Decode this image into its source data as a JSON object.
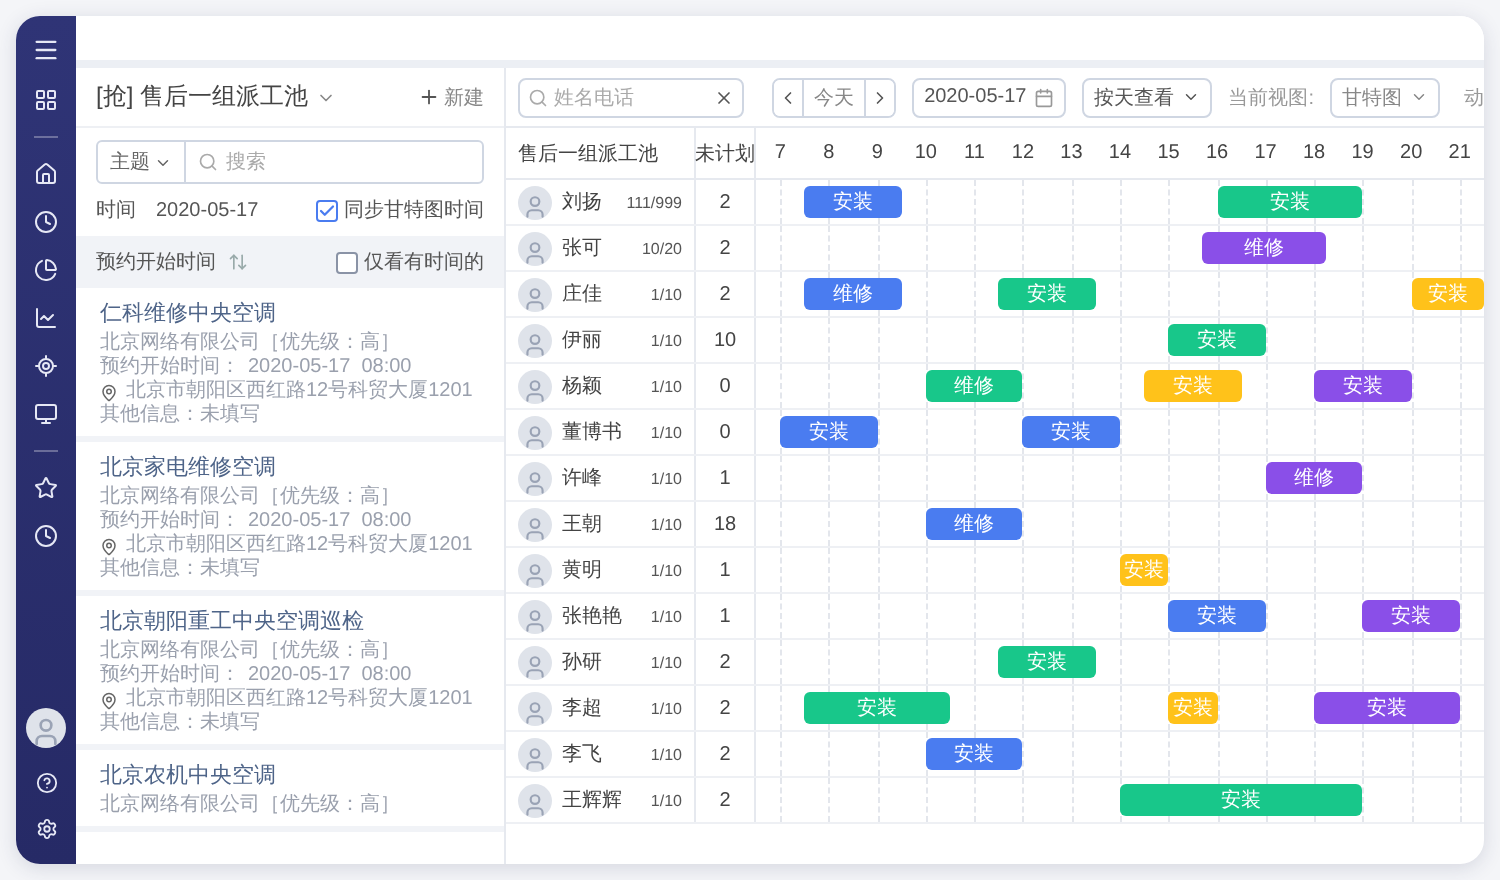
{
  "pool_panel": {
    "title": "[抢] 售后一组派工池",
    "new_button": "新建",
    "topic_select": "主题",
    "search_placeholder": "搜索",
    "time_label": "时间",
    "time_value": "2020-05-17",
    "sync_checkbox": {
      "label": "同步甘特图时间",
      "checked": true
    },
    "sort_label": "预约开始时间",
    "only_timed_checkbox": {
      "label": "仅看有时间的",
      "checked": false
    },
    "cards": [
      {
        "title": "仁科维修中央空调",
        "company": "北京网络有限公司［优先级：高］",
        "time_label": "预约开始时间：",
        "time": "2020-05-17  08:00",
        "address": "北京市朝阳区西红路12号科贸大厦1201",
        "other": "其他信息：未填写"
      },
      {
        "title": "北京家电维修空调",
        "company": "北京网络有限公司［优先级：高］",
        "time_label": "预约开始时间：",
        "time": "2020-05-17  08:00",
        "address": "北京市朝阳区西红路12号科贸大厦1201",
        "other": "其他信息：未填写"
      },
      {
        "title": "北京朝阳重工中央空调巡检",
        "company": "北京网络有限公司［优先级：高］",
        "time_label": "预约开始时间：",
        "time": "2020-05-17  08:00",
        "address": "北京市朝阳区西红路12号科贸大厦1201",
        "other": "其他信息：未填写"
      },
      {
        "title": "北京农机中央空调",
        "company": "北京网络有限公司［优先级：高］"
      }
    ]
  },
  "toolbar": {
    "search_placeholder": "姓名电话",
    "today_button": "今天",
    "date": "2020-05-17",
    "range_select": "按天查看",
    "view_label": "当前视图:",
    "view_select": "甘特图",
    "cut_text": "动"
  },
  "gantt": {
    "name_header": "售后一组派工池",
    "count_header": "未计划",
    "hours": [
      "7",
      "8",
      "9",
      "10",
      "11",
      "12",
      "13",
      "14",
      "15",
      "16",
      "17",
      "18",
      "19",
      "20",
      "21"
    ],
    "rows": [
      {
        "name": "刘扬",
        "quota": "111/999",
        "unplanned": "2",
        "tasks": [
          {
            "label": "安装",
            "color": "#4a7cf0"
          },
          {
            "label": "安装",
            "color": "#18c78a"
          }
        ]
      },
      {
        "name": "张可",
        "quota": "10/20",
        "unplanned": "2",
        "tasks": [
          {
            "label": "维修",
            "color": "#8a4fe8"
          }
        ]
      },
      {
        "name": "庄佳",
        "quota": "1/10",
        "unplanned": "2",
        "tasks": [
          {
            "label": "维修",
            "color": "#4a7cf0"
          },
          {
            "label": "安装",
            "color": "#18c78a"
          },
          {
            "label": "安装",
            "color": "#ffc21a"
          }
        ]
      },
      {
        "name": "伊丽",
        "quota": "1/10",
        "unplanned": "10",
        "tasks": [
          {
            "label": "安装",
            "color": "#18c78a"
          }
        ]
      },
      {
        "name": "杨颖",
        "quota": "1/10",
        "unplanned": "0",
        "tasks": [
          {
            "label": "维修",
            "color": "#18c78a"
          },
          {
            "label": "安装",
            "color": "#ffc21a"
          },
          {
            "label": "安装",
            "color": "#8a4fe8"
          }
        ]
      },
      {
        "name": "董博书",
        "quota": "1/10",
        "unplanned": "0",
        "tasks": [
          {
            "label": "安装",
            "color": "#4a7cf0"
          },
          {
            "label": "安装",
            "color": "#4a7cf0"
          }
        ]
      },
      {
        "name": "许峰",
        "quota": "1/10",
        "unplanned": "1",
        "tasks": [
          {
            "label": "维修",
            "color": "#8a4fe8"
          }
        ]
      },
      {
        "name": "王朝",
        "quota": "1/10",
        "unplanned": "18",
        "tasks": [
          {
            "label": "维修",
            "color": "#4a7cf0"
          }
        ]
      },
      {
        "name": "黄明",
        "quota": "1/10",
        "unplanned": "1",
        "tasks": [
          {
            "label": "安装",
            "color": "#ffc21a"
          }
        ]
      },
      {
        "name": "张艳艳",
        "quota": "1/10",
        "unplanned": "1",
        "tasks": [
          {
            "label": "安装",
            "color": "#4a7cf0"
          },
          {
            "label": "安装",
            "color": "#8a4fe8"
          }
        ]
      },
      {
        "name": "孙研",
        "quota": "1/10",
        "unplanned": "2",
        "tasks": [
          {
            "label": "安装",
            "color": "#18c78a"
          }
        ]
      },
      {
        "name": "李超",
        "quota": "1/10",
        "unplanned": "2",
        "tasks": [
          {
            "label": "安装",
            "color": "#18c78a"
          },
          {
            "label": "安装",
            "color": "#ffc21a"
          },
          {
            "label": "安装",
            "color": "#8a4fe8"
          }
        ]
      },
      {
        "name": "李飞",
        "quota": "1/10",
        "unplanned": "2",
        "tasks": [
          {
            "label": "安装",
            "color": "#4a7cf0"
          }
        ]
      },
      {
        "name": "王辉辉",
        "quota": "1/10",
        "unplanned": "2",
        "tasks": [
          {
            "label": "安装",
            "color": "#18c78a"
          }
        ]
      }
    ]
  }
}
